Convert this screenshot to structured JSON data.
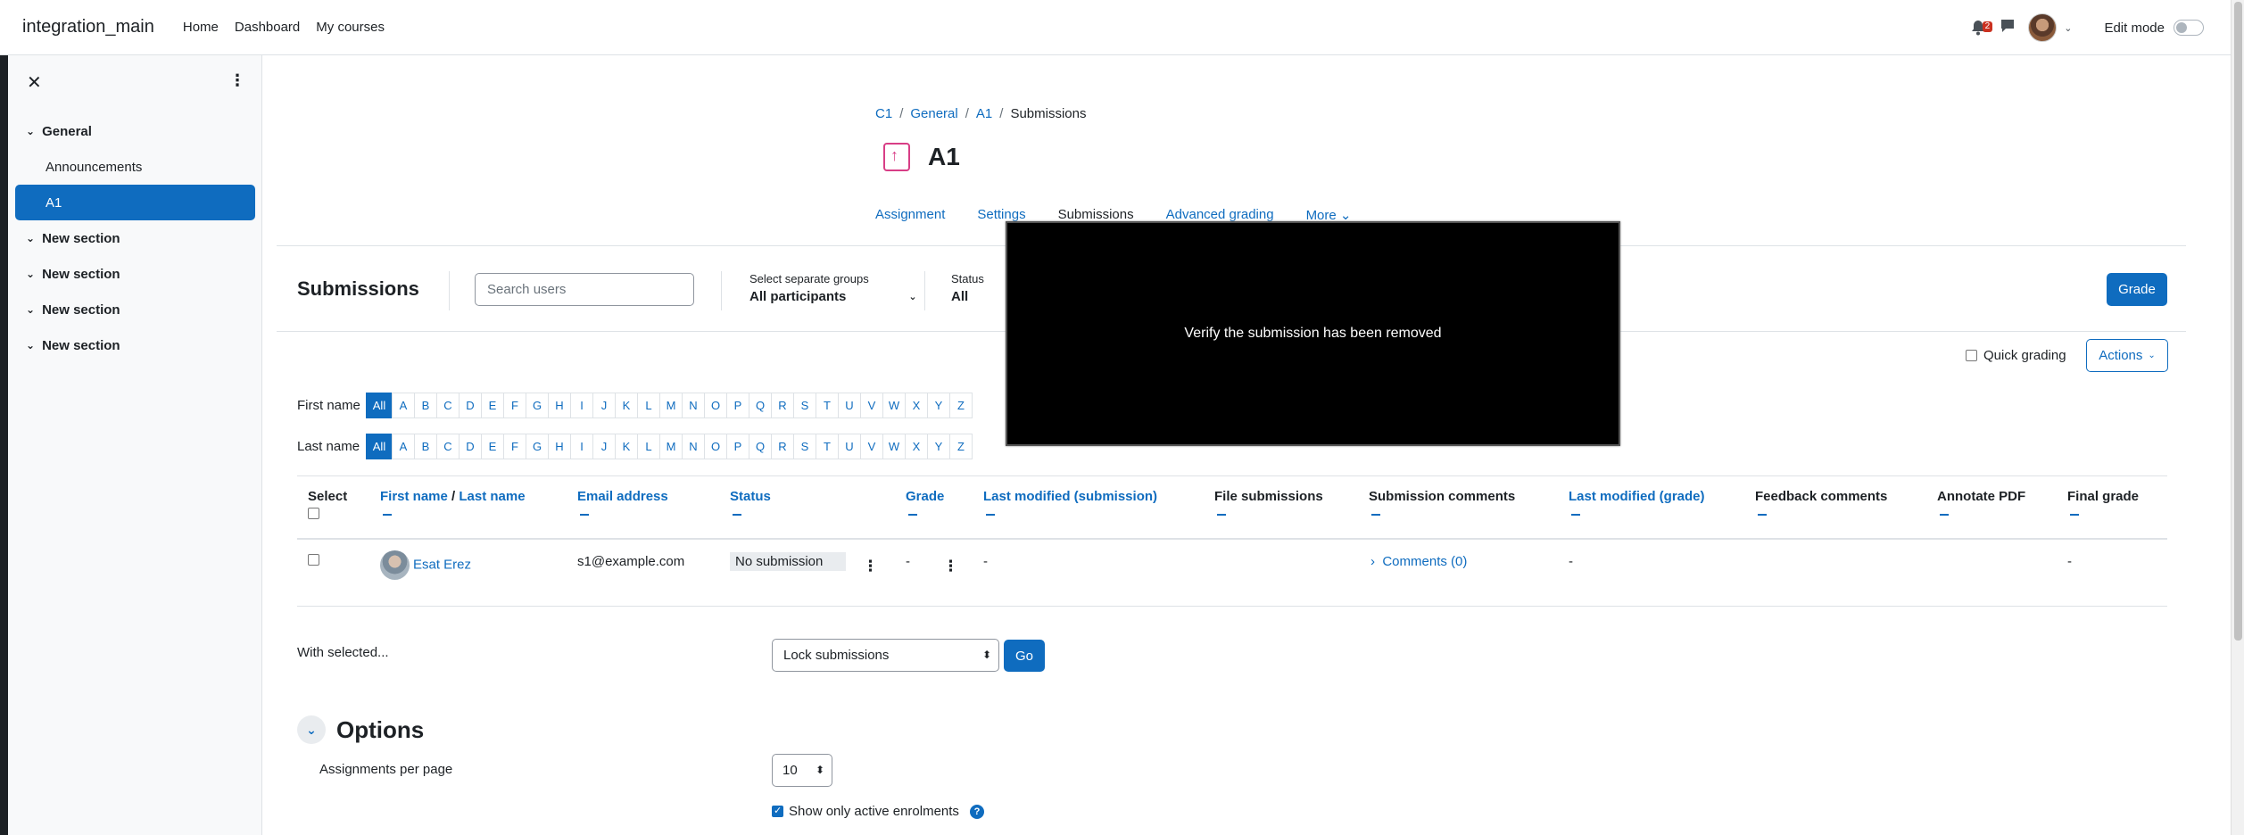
{
  "topbar": {
    "site_name": "integration_main",
    "nav": [
      "Home",
      "Dashboard",
      "My courses"
    ],
    "notification_count": "2",
    "edit_mode_label": "Edit mode"
  },
  "drawer": {
    "sections": [
      {
        "title": "General",
        "activities": [
          "Announcements",
          "A1"
        ]
      },
      {
        "title": "New section"
      },
      {
        "title": "New section"
      },
      {
        "title": "New section"
      },
      {
        "title": "New section"
      }
    ],
    "active_activity": "A1"
  },
  "breadcrumb": [
    "C1",
    "General",
    "A1",
    "Submissions"
  ],
  "page_title": "A1",
  "secondary_nav": [
    "Assignment",
    "Settings",
    "Submissions",
    "Advanced grading",
    "More"
  ],
  "toolbar": {
    "title": "Submissions",
    "search_placeholder": "Search users",
    "groups_label": "Select separate groups",
    "groups_value": "All participants",
    "status_label": "Status",
    "status_value": "All",
    "grade_button": "Grade",
    "quick_grading_label": "Quick grading",
    "actions_button": "Actions"
  },
  "initials": {
    "first_name_label": "First name",
    "last_name_label": "Last name",
    "letters": [
      "All",
      "A",
      "B",
      "C",
      "D",
      "E",
      "F",
      "G",
      "H",
      "I",
      "J",
      "K",
      "L",
      "M",
      "N",
      "O",
      "P",
      "Q",
      "R",
      "S",
      "T",
      "U",
      "V",
      "W",
      "X",
      "Y",
      "Z"
    ]
  },
  "table": {
    "headers": {
      "select": "Select",
      "first_name": "First name",
      "last_name": "Last name",
      "email": "Email address",
      "status": "Status",
      "grade": "Grade",
      "last_modified_submission": "Last modified (submission)",
      "file_submissions": "File submissions",
      "submission_comments": "Submission comments",
      "last_modified_grade": "Last modified (grade)",
      "feedback_comments": "Feedback comments",
      "annotate_pdf": "Annotate PDF",
      "final_grade": "Final grade"
    },
    "rows": [
      {
        "name": "Esat Erez",
        "email": "s1@example.com",
        "status": "No submission",
        "grade": "-",
        "last_modified_submission": "-",
        "comments": "Comments (0)",
        "last_modified_grade": "-",
        "final_grade": "-"
      }
    ]
  },
  "bulk": {
    "with_selected_label": "With selected...",
    "operation_value": "Lock submissions",
    "go_button": "Go"
  },
  "options": {
    "heading": "Options",
    "per_page_label": "Assignments per page",
    "per_page_value": "10",
    "active_enrolments_label": "Show only active enrolments"
  },
  "overlay": {
    "message": "Verify the submission has been removed"
  }
}
